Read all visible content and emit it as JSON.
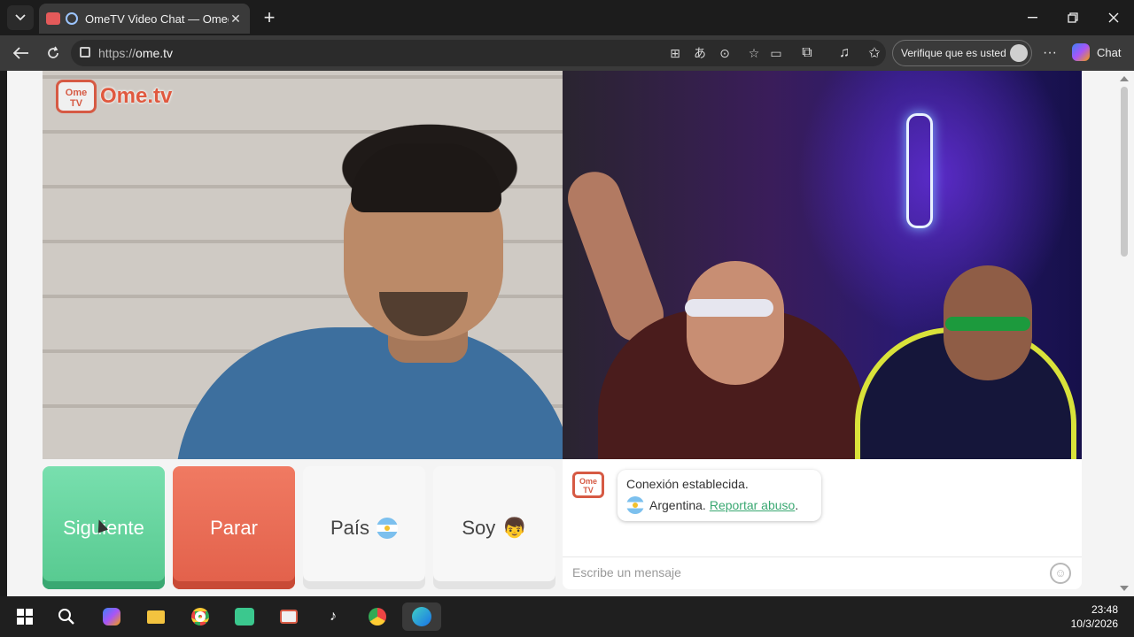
{
  "browser": {
    "tab": {
      "title": "OmeTV Video Chat — Omegl"
    },
    "url_prefix": "https://",
    "url_domain": "ome.tv",
    "verify_label": "Verifique que es usted",
    "chat_label": "Chat"
  },
  "page": {
    "logo_badge": "Ome TV",
    "logo_text": "Ome.tv",
    "buttons": {
      "next": "Siguiente",
      "stop": "Parar",
      "country": "País",
      "gender": "Soy"
    },
    "chat": {
      "bot_badge": "Ome TV",
      "status": "Conexión establecida.",
      "country": "Argentina.",
      "report_link": "Reportar abuso",
      "report_suffix": ".",
      "placeholder": "Escribe un mensaje"
    }
  },
  "taskbar": {
    "time": "23:48",
    "date": "10/3/2026"
  }
}
